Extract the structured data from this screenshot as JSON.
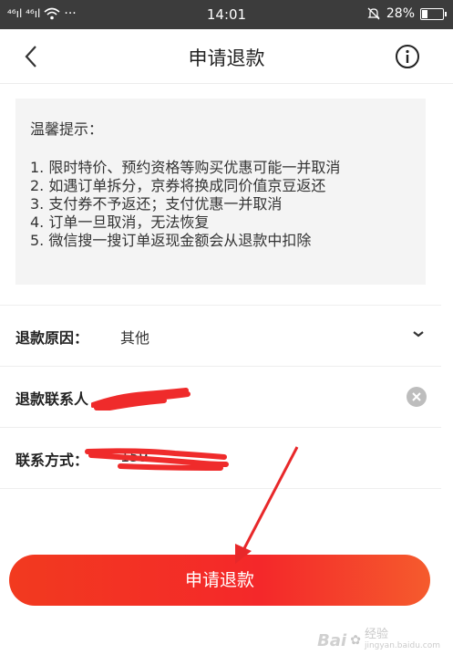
{
  "status_bar": {
    "signal": "⁴⁶ıl ⁴⁶ıl",
    "dots": "···",
    "time": "14:01",
    "battery_percent": "28%",
    "battery_level": 0.28
  },
  "nav": {
    "title": "申请退款"
  },
  "notice": {
    "title": "温馨提示：",
    "items": [
      "1. 限时特价、预约资格等购买优惠可能一并取消",
      "2. 如遇订单拆分，京券将换成同价值京豆返还",
      "3. 支付券不予返还；支付优惠一并取消",
      "4. 订单一旦取消，无法恢复",
      "5. 微信搜一搜订单返现金额会从退款中扣除"
    ]
  },
  "form": {
    "reason_label": "退款原因：",
    "reason_value": "其他",
    "contact_label": "退款联系人",
    "phone_label": "联系方式：",
    "phone_value": "159"
  },
  "submit_label": "申请退款",
  "watermark": {
    "logo": "Bai",
    "text": "经验",
    "sub": "jingyan.baidu.com"
  },
  "colors": {
    "accent": "#f4282a",
    "annotation": "#e8282a"
  }
}
